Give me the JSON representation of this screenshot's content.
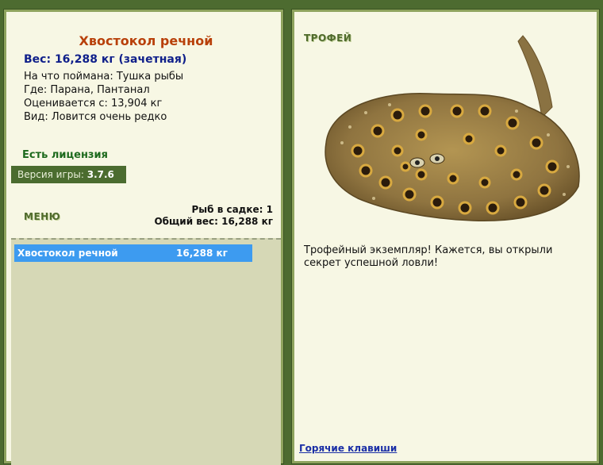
{
  "left": {
    "fish_name": "Хвостокол речной",
    "weight_line": "Вес: 16,288 кг (зачетная)",
    "info_lines": [
      "На что поймана: Тушка рыбы",
      "Где: Парана, Пантанал",
      "Оценивается с: 13,904 кг",
      "Вид: Ловится очень редко"
    ],
    "license": "Есть лицензия",
    "version_label": "Версия игры:",
    "version_value": "3.7.6",
    "menu_label": "МЕНЮ",
    "stats": {
      "fish_in_net": "Рыб в садке: 1",
      "total_weight": "Общий вес: 16,288 кг"
    },
    "catch_list": [
      {
        "name": "Хвостокол речной",
        "weight": "16,288 кг"
      }
    ]
  },
  "right": {
    "trophy_label": "ТРОФЕЙ",
    "trophy_text": "Трофейный экземпляр! Кажется, вы открыли секрет успешной ловли!",
    "hotkeys_link": "Горячие клавиши"
  },
  "colors": {
    "background": "#4d6b30",
    "panel": "#f7f7e4",
    "title": "#b8400a",
    "weight": "#0f1f8a",
    "selection": "#3d9bf0"
  }
}
